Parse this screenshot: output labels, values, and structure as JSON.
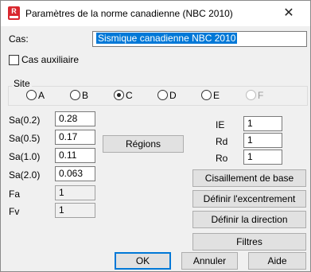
{
  "window": {
    "title": "Paramètres de la norme canadienne (NBC 2010)",
    "app_icon_letter": "R"
  },
  "case": {
    "label": "Cas:",
    "value": "Sismique canadienne NBC 2010"
  },
  "aux_case": {
    "label": "Cas auxiliaire",
    "checked": false
  },
  "site": {
    "label": "Site",
    "options": [
      "A",
      "B",
      "C",
      "D",
      "E",
      "F"
    ],
    "selected": "C",
    "disabled": [
      "F"
    ]
  },
  "sa_fields": [
    {
      "label": "Sa(0.2)",
      "value": "0.28"
    },
    {
      "label": "Sa(0.5)",
      "value": "0.17"
    },
    {
      "label": "Sa(1.0)",
      "value": "0.11"
    },
    {
      "label": "Sa(2.0)",
      "value": "0.063"
    }
  ],
  "f_fields": [
    {
      "label": "Fa",
      "value": "1"
    },
    {
      "label": "Fv",
      "value": "1"
    }
  ],
  "regions_button": "Régions",
  "factors": [
    {
      "label": "IE",
      "value": "1"
    },
    {
      "label": "Rd",
      "value": "1"
    },
    {
      "label": "Ro",
      "value": "1"
    }
  ],
  "actions": {
    "base_shear": "Cisaillement de base",
    "eccentricity": "Définir l'excentrement",
    "direction": "Définir la direction",
    "filters": "Filtres"
  },
  "footer": {
    "ok": "OK",
    "cancel": "Annuler",
    "help": "Aide"
  }
}
